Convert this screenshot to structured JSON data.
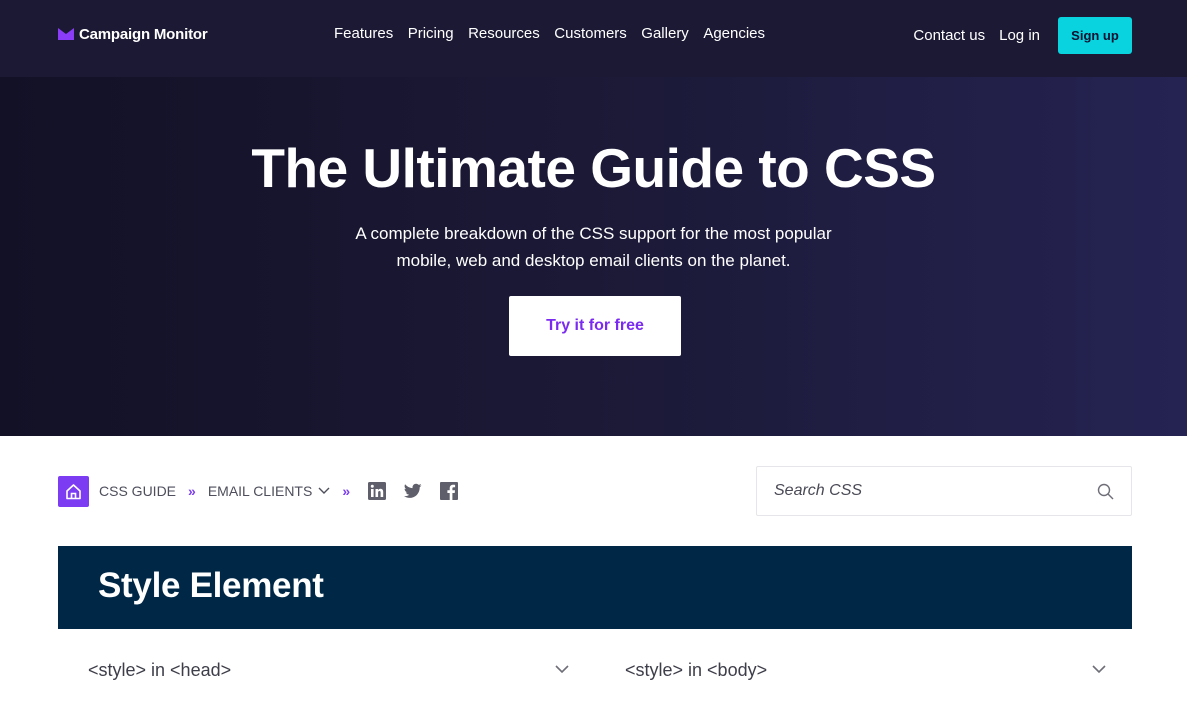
{
  "brand": {
    "name": "Campaign Monitor",
    "logo_icon": "campaign-monitor-logo-icon",
    "accent_color": "#7b3cf2"
  },
  "nav": {
    "links": [
      "Features",
      "Pricing",
      "Resources",
      "Customers",
      "Gallery",
      "Agencies"
    ],
    "contact_label": "Contact us",
    "login_label": "Log in",
    "signup_label": "Sign up",
    "signup_color": "#08d3de"
  },
  "hero": {
    "title": "The Ultimate Guide to CSS",
    "subtitle_line1": "A complete breakdown of the CSS support for the most popular",
    "subtitle_line2": "mobile, web and desktop email clients on the planet.",
    "cta_label": "Try it for free",
    "background_color": "#1b1934"
  },
  "breadcrumb": {
    "home_icon": "home-icon",
    "items": [
      "CSS GUIDE",
      "EMAIL CLIENTS"
    ],
    "separator": "»",
    "dropdown_icon": "chevron-down-icon",
    "social_icons": [
      "linkedin-icon",
      "twitter-icon",
      "facebook-icon"
    ]
  },
  "search": {
    "placeholder": "Search CSS",
    "icon": "search-icon"
  },
  "section": {
    "title": "Style Element",
    "background_color": "#002846",
    "accordions": [
      "<style> in <head>",
      "<style> in <body>"
    ]
  }
}
